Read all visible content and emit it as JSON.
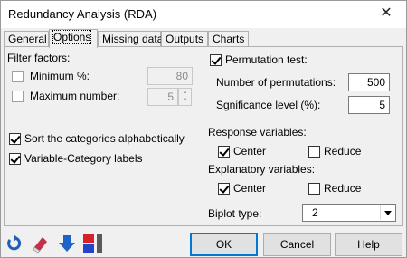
{
  "window": {
    "title": "Redundancy Analysis (RDA)",
    "close_glyph": "✕"
  },
  "tabs": [
    {
      "label": "General",
      "active": false
    },
    {
      "label": "Options",
      "active": true
    },
    {
      "label": "Missing data",
      "active": false
    },
    {
      "label": "Outputs",
      "active": false
    },
    {
      "label": "Charts",
      "active": false
    }
  ],
  "options": {
    "filter_factors": {
      "label": "Filter factors:",
      "minimum": {
        "label": "Minimum %:",
        "checked": false,
        "value": "80"
      },
      "maximum": {
        "label": "Maximum number:",
        "checked": false,
        "value": "5"
      }
    },
    "sort_alpha": {
      "label": "Sort the categories alphabetically",
      "checked": true
    },
    "var_cat_labels": {
      "label": "Variable-Category labels",
      "checked": true
    },
    "permutation": {
      "label": "Permutation test:",
      "checked": true,
      "num_perm_label": "Number of permutations:",
      "num_perm_value": "500",
      "sig_label": "Sgnificance level (%):",
      "sig_value": "5"
    },
    "response": {
      "label": "Response variables:",
      "center": {
        "label": "Center",
        "checked": true
      },
      "reduce": {
        "label": "Reduce",
        "checked": false
      }
    },
    "explanatory": {
      "label": "Explanatory variables:",
      "center": {
        "label": "Center",
        "checked": true
      },
      "reduce": {
        "label": "Reduce",
        "checked": false
      }
    },
    "biplot": {
      "label": "Biplot type:",
      "value": "2"
    }
  },
  "buttons": {
    "ok": "OK",
    "cancel": "Cancel",
    "help": "Help"
  },
  "toolbar_icons": [
    "reset-icon",
    "eraser-icon",
    "down-arrow-icon",
    "sheet-icon"
  ],
  "colors": {
    "accent": "#0078d7",
    "reset": "#1f5fb5",
    "eraser": "#c0314b",
    "arrow": "#1e63c8",
    "sheet_red": "#d8202a",
    "sheet_blue": "#2244c8"
  }
}
